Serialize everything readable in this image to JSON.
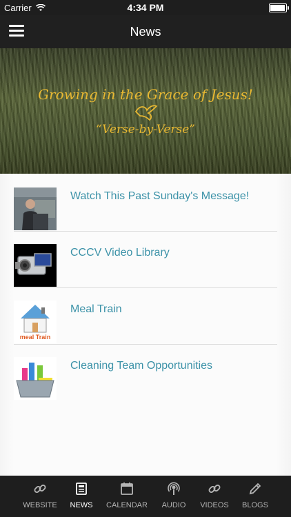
{
  "status_bar": {
    "carrier": "Carrier",
    "time": "4:34 PM",
    "battery_level": 0.95
  },
  "navbar": {
    "title": "News"
  },
  "banner": {
    "headline": "Growing in the Grace of Jesus!",
    "subheadline": "“Verse-by-Verse”"
  },
  "news_items": [
    {
      "label": "Watch This Past Sunday's Message!",
      "thumb_icon": "pastor-photo"
    },
    {
      "label": "CCCV Video Library",
      "thumb_icon": "video-camera-icon"
    },
    {
      "label": "Meal Train",
      "thumb_icon": "meal-train-logo",
      "thumb_text": "meal Train"
    },
    {
      "label": "Cleaning Team Opportunities",
      "thumb_icon": "cleaning-supplies-icon"
    }
  ],
  "tabbar": {
    "active": "NEWS",
    "tabs": [
      {
        "label": "WEBSITE",
        "icon": "link-icon"
      },
      {
        "label": "NEWS",
        "icon": "newspaper-icon"
      },
      {
        "label": "CALENDAR",
        "icon": "calendar-icon"
      },
      {
        "label": "AUDIO",
        "icon": "podcast-icon"
      },
      {
        "label": "VIDEOS",
        "icon": "link-icon"
      },
      {
        "label": "BLOGS",
        "icon": "pencil-icon"
      }
    ]
  },
  "colors": {
    "accent_link": "#3c92a8",
    "banner_text": "#e8b832",
    "bar_bg": "#1e1e1e"
  }
}
